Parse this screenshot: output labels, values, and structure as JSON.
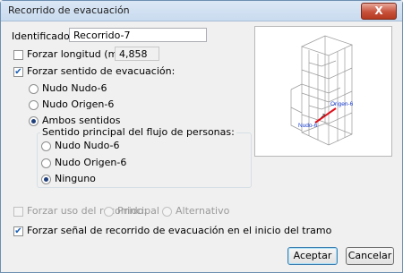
{
  "window": {
    "title": "Recorrido de evacuación",
    "close_label": "X"
  },
  "identificador": {
    "label": "Identificador:",
    "value": "Recorrido-7"
  },
  "forzar_longitud": {
    "label": "Forzar longitud (m.):",
    "value": "4,858",
    "checked": false
  },
  "forzar_sentido": {
    "label": "Forzar sentido de evacuación:",
    "checked": true,
    "options": [
      "Nudo Nudo-6",
      "Nudo Origen-6",
      "Ambos sentidos"
    ],
    "selected": "Ambos sentidos"
  },
  "sentido_principal": {
    "legend": "Sentido principal del flujo de personas:",
    "options": [
      "Nudo Nudo-6",
      "Nudo Origen-6",
      "Ninguno"
    ],
    "selected": "Ninguno"
  },
  "forzar_uso": {
    "label": "Forzar uso del recorrido:",
    "options": [
      "Principal",
      "Alternativo"
    ],
    "checked": false
  },
  "forzar_senal": {
    "label": "Forzar señal de recorrido de evacuación en el inicio del tramo",
    "checked": true
  },
  "preview": {
    "label_origen": "Origen-6",
    "label_nudo": "Nudo-6"
  },
  "buttons": {
    "accept": "Aceptar",
    "cancel": "Cancelar"
  },
  "colors": {
    "path": "#e0101a",
    "node_label": "#1a3fd0"
  }
}
